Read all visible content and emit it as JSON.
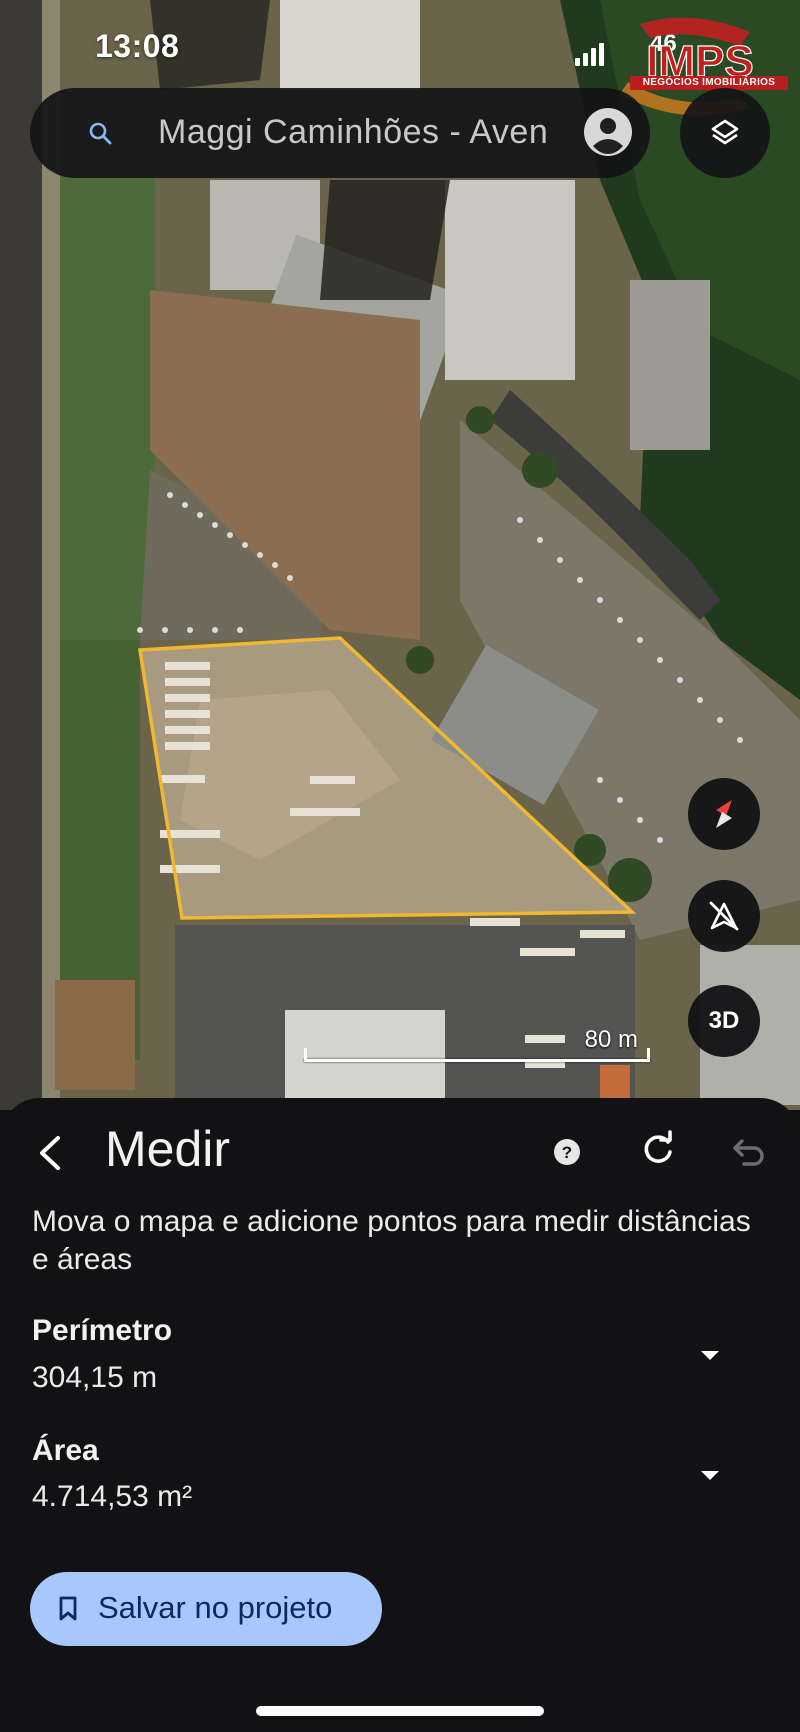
{
  "status_bar": {
    "time": "13:08",
    "battery": "46"
  },
  "watermark": {
    "brand": "IMPS",
    "tagline": "NEGÓCIOS IMOBILIÁRIOS"
  },
  "search": {
    "text": "Maggi Caminhões - Aven"
  },
  "map": {
    "scale_label": "80 m",
    "measure_polygon_color": "#f0b830",
    "three_d_label": "3D"
  },
  "measure_panel": {
    "title": "Medir",
    "description": "Mova o mapa e adicione pontos para medir distâncias e áreas",
    "perimeter_label": "Perímetro",
    "perimeter_value": "304,15 m",
    "area_label": "Área",
    "area_value": "4.714,53 m²",
    "save_label": "Salvar no projeto"
  },
  "colors": {
    "sheet_bg": "#121214",
    "save_button_bg": "#a8c7fa",
    "save_button_text": "#0b2a5c"
  }
}
